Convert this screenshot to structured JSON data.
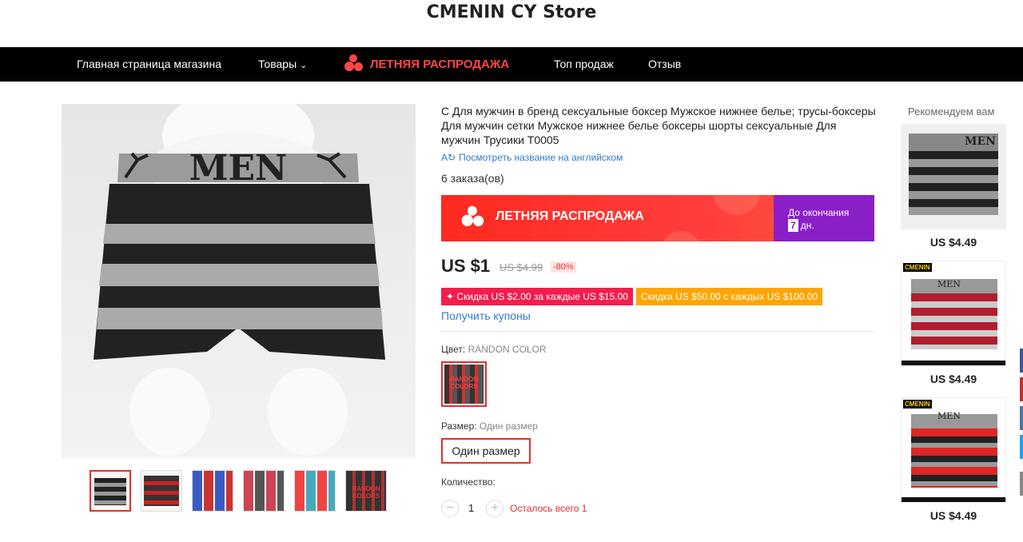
{
  "store": {
    "name": "CMENIN CY Store"
  },
  "nav": {
    "home": "Главная страница магазина",
    "products": "Товары",
    "sale": "ЛЕТНЯЯ РАСПРОДАЖА",
    "top": "Топ продаж",
    "reviews": "Отзыв"
  },
  "product": {
    "title": "С Для мужчин в бренд сексуальные боксер Мужское нижнее белье; трусы-боксеры Для мужчин сетки Мужское нижнее белье боксеры шорты сексуальные Для мужчин Трусики T0005",
    "translate_link": "Посмотреть название на английском",
    "orders": "6 заказа(ов)",
    "price": "US $1",
    "old_price": "US $4.99",
    "discount": "-80%",
    "main_image_brand": "MEN"
  },
  "banner": {
    "text": "ЛЕТНЯЯ РАСПРОДАЖА",
    "ends_label": "До окончания",
    "days": "7",
    "days_unit": "дн."
  },
  "coupons": {
    "coupon1": "✦ Скидка US $2.00 за каждые US $15.00",
    "coupon2": "Скидка US $50.00 с каждых US $100.00",
    "get": "Получить купоны"
  },
  "options": {
    "color_label": "Цвет:",
    "color_value": "RANDON COLOR",
    "swatch_text": "RANDON COLORS",
    "size_label": "Размер:",
    "size_value": "Один размер",
    "size_button": "Один размер",
    "qty_label": "Количество:",
    "qty_value": "1",
    "qty_minus": "−",
    "qty_plus": "+",
    "stock": "Осталось всего 1"
  },
  "thumbs": [
    "MEN",
    "MEN",
    "",
    "",
    "",
    "RANDON COLORS"
  ],
  "recommend": {
    "title": "Рекомендуем вам",
    "items": [
      {
        "price": "US $4.49",
        "brand": "MEN"
      },
      {
        "price": "US $4.49",
        "brand": "MEN",
        "logo": "CMENIN"
      },
      {
        "price": "US $4.49",
        "brand": "MEN",
        "logo": "CMENIN"
      }
    ]
  },
  "colors": {
    "accent": "#e62e2e",
    "link": "#2e7bd6",
    "nav_bg": "#000000",
    "purple": "#8a1fc8",
    "coupon_pink": "#f31d4b",
    "coupon_orange": "#ffa500"
  }
}
